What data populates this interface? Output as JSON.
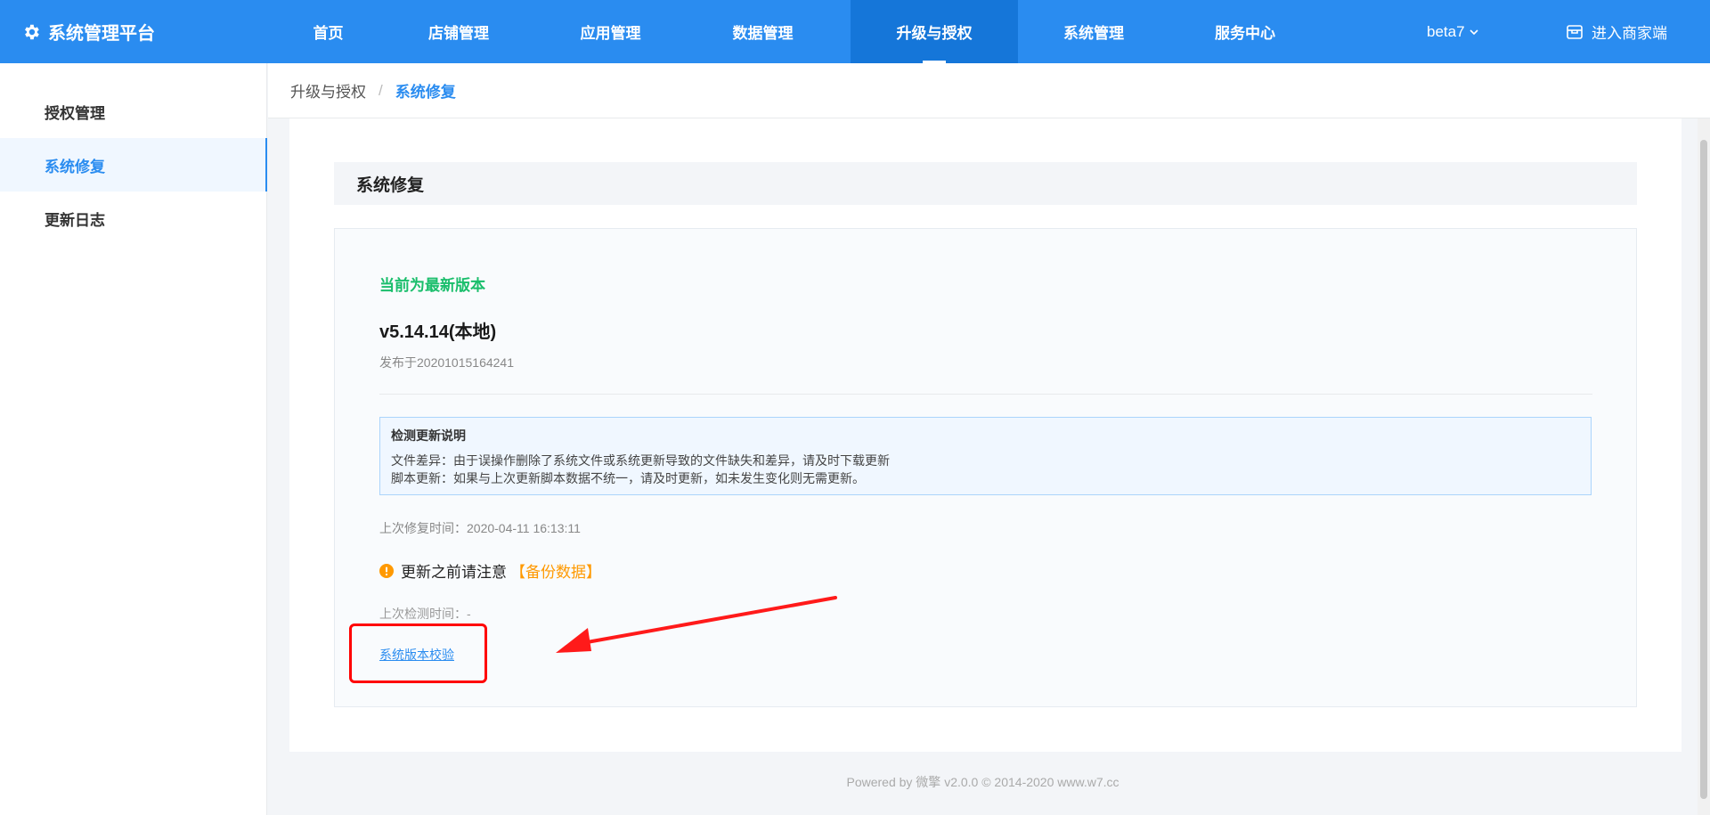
{
  "topbar": {
    "brand": "系统管理平台",
    "nav": [
      "首页",
      "店铺管理",
      "应用管理",
      "数据管理",
      "升级与授权",
      "系统管理",
      "服务中心"
    ],
    "active_nav": "升级与授权",
    "beta": "beta7",
    "enter_label": "进入商家端",
    "color": "#2a8cf0"
  },
  "sidebar": {
    "items": [
      "授权管理",
      "系统修复",
      "更新日志"
    ],
    "active": "系统修复"
  },
  "breadcrumb": {
    "parent": "升级与授权",
    "separator": "/",
    "current": "系统修复"
  },
  "main": {
    "section_title": "系统修复",
    "status": "当前为最新版本",
    "version": "v5.14.14(本地)",
    "released": "发布于20201015164241",
    "notice": {
      "title": "检测更新说明",
      "line1": "文件差异：由于误操作删除了系统文件或系统更新导致的文件缺失和差异，请及时下载更新",
      "line2": "脚本更新：如果与上次更新脚本数据不统一，请及时更新，如未发生变化则无需更新。"
    },
    "last_repair": "上次修复时间：2020-04-11 16:13:11",
    "warning": "更新之前请注意",
    "warning_highlight": "【备份数据】",
    "last_check": "上次检测时间：-",
    "verify_link": "系统版本校验"
  },
  "footer": "Powered by 微擎 v2.0.0 © 2014-2020 www.w7.cc"
}
